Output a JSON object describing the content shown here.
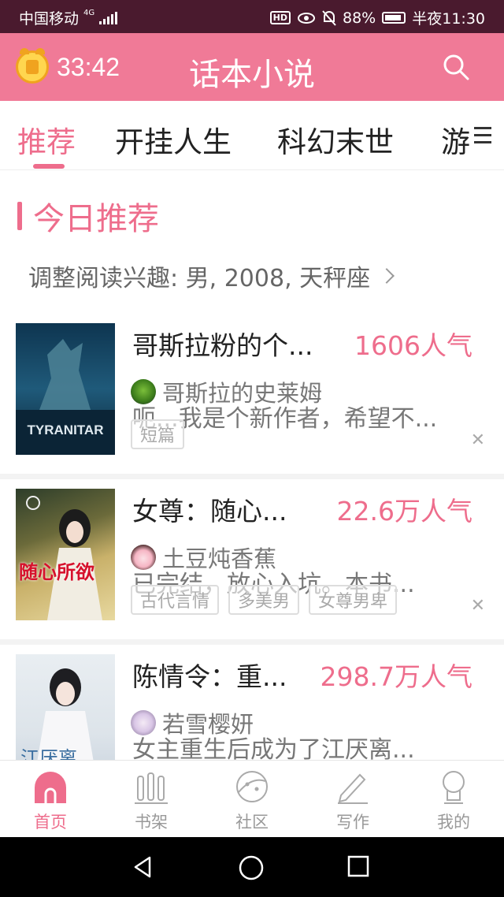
{
  "status_bar": {
    "carrier": "中国移动",
    "network": "4G",
    "hd": "HD",
    "battery": "88%",
    "time": "半夜11:30"
  },
  "header": {
    "timer": "33:42",
    "title": "话本小说",
    "accent_color": "#f07a97"
  },
  "tabs": [
    {
      "label": "推荐",
      "active": true
    },
    {
      "label": "开挂人生",
      "active": false
    },
    {
      "label": "科幻末世",
      "active": false
    },
    {
      "label": "游",
      "active": false
    }
  ],
  "section": {
    "title": "今日推荐",
    "interest": "调整阅读兴趣: 男, 2008, 天秤座"
  },
  "books": [
    {
      "title": "哥斯拉粉的个...",
      "popularity": "1606人气",
      "author": "哥斯拉的史莱姆",
      "description": "呃...我是个新作者，希望不...",
      "tags": [
        "短篇"
      ],
      "cover_text": "TYRANITAR",
      "dismiss": "✕"
    },
    {
      "title": "女尊：随心...",
      "popularity": "22.6万人气",
      "author": "土豆炖香蕉",
      "description": "已完结，放心入坑。本书...",
      "tags": [
        "古代言情",
        "多美男",
        "女尊男卑"
      ],
      "cover_text": "随心所欲",
      "dismiss": "✕"
    },
    {
      "title": "陈情令：重...",
      "popularity": "298.7万人气",
      "author": "若雪樱妍",
      "description": "女主重生后成为了江厌离...",
      "tags": [],
      "cover_text": "江厌离",
      "dismiss": ""
    }
  ],
  "bottom_nav": [
    {
      "label": "首页",
      "icon": "home-icon",
      "active": true
    },
    {
      "label": "书架",
      "icon": "bookshelf-icon",
      "active": false
    },
    {
      "label": "社区",
      "icon": "community-icon",
      "active": false
    },
    {
      "label": "写作",
      "icon": "write-icon",
      "active": false
    },
    {
      "label": "我的",
      "icon": "profile-icon",
      "active": false
    }
  ]
}
